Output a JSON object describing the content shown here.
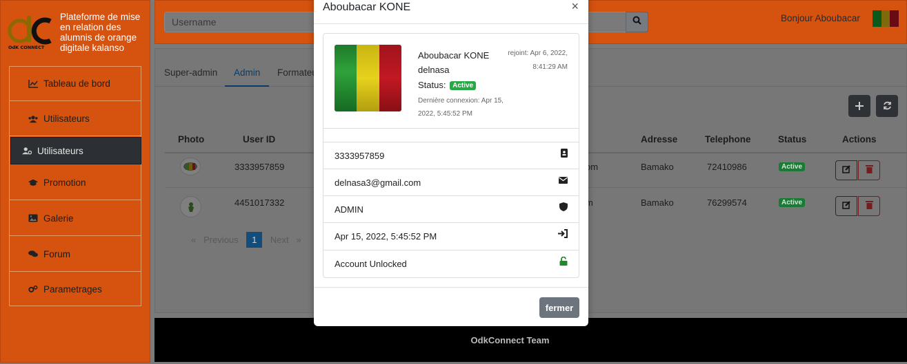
{
  "brand": {
    "logo_text": "OdK CONNECT",
    "tagline": "Plateforme de mise en relation des alumnis de orange digitale kalanso"
  },
  "sidebar": {
    "items": [
      {
        "label": "Tableau de bord",
        "icon": "chart-line-icon"
      },
      {
        "label": "Utilisateurs",
        "icon": "users-icon"
      },
      {
        "label": "Utilisateurs",
        "icon": "user-cog-icon",
        "active": true
      },
      {
        "label": "Promotion",
        "icon": "graduation-cap-icon"
      },
      {
        "label": "Galerie",
        "icon": "image-icon"
      },
      {
        "label": "Forum",
        "icon": "comments-icon"
      },
      {
        "label": "Parametrages",
        "icon": "cogs-icon"
      }
    ]
  },
  "header": {
    "search_placeholder": "Username",
    "greeting": "Bonjour Aboubacar"
  },
  "tabs": [
    "Super-admin",
    "Admin",
    "Formateur"
  ],
  "active_tab": "Admin",
  "table": {
    "columns": [
      "Photo",
      "User ID",
      "Adresse",
      "Telephone",
      "Status",
      "Actions"
    ],
    "rows": [
      {
        "user_id": "3333957859",
        "email_tail": "om",
        "adresse": "Bamako",
        "telephone": "72410986",
        "status": "Active"
      },
      {
        "user_id": "4451017332",
        "email_tail": "m",
        "adresse": "Bamako",
        "telephone": "76299574",
        "status": "Active"
      }
    ]
  },
  "pagination": {
    "prev": "Previous",
    "current": "1",
    "next": "Next",
    "prev_glyph": "«",
    "next_glyph": "»"
  },
  "footer": {
    "text": "OdkConnect Team"
  },
  "modal": {
    "title": "Aboubacar KONE",
    "close_glyph": "×",
    "profile": {
      "name": "Aboubacar KONE",
      "username": "delnasa",
      "status_label": "Status:",
      "status": "Active",
      "last_login": "Dernière connexion: Apr 15, 2022, 5:45:52 PM",
      "joined": "rejoint: Apr 6, 2022, 8:41:29 AM"
    },
    "details": [
      {
        "value": "3333957859",
        "icon": "id-card-icon"
      },
      {
        "value": "delnasa3@gmail.com",
        "icon": "envelope-icon"
      },
      {
        "value": "ADMIN",
        "icon": "shield-icon"
      },
      {
        "value": "Apr 15, 2022, 5:45:52 PM",
        "icon": "sign-in-icon"
      },
      {
        "value": "Account Unlocked",
        "icon": "unlock-icon"
      }
    ],
    "close_button": "fermer"
  },
  "colors": {
    "brand_orange": "#ff6600",
    "success_green": "#28a745",
    "mali_green": "#14b53a",
    "mali_yellow": "#fcd116",
    "mali_red": "#ce1126"
  }
}
